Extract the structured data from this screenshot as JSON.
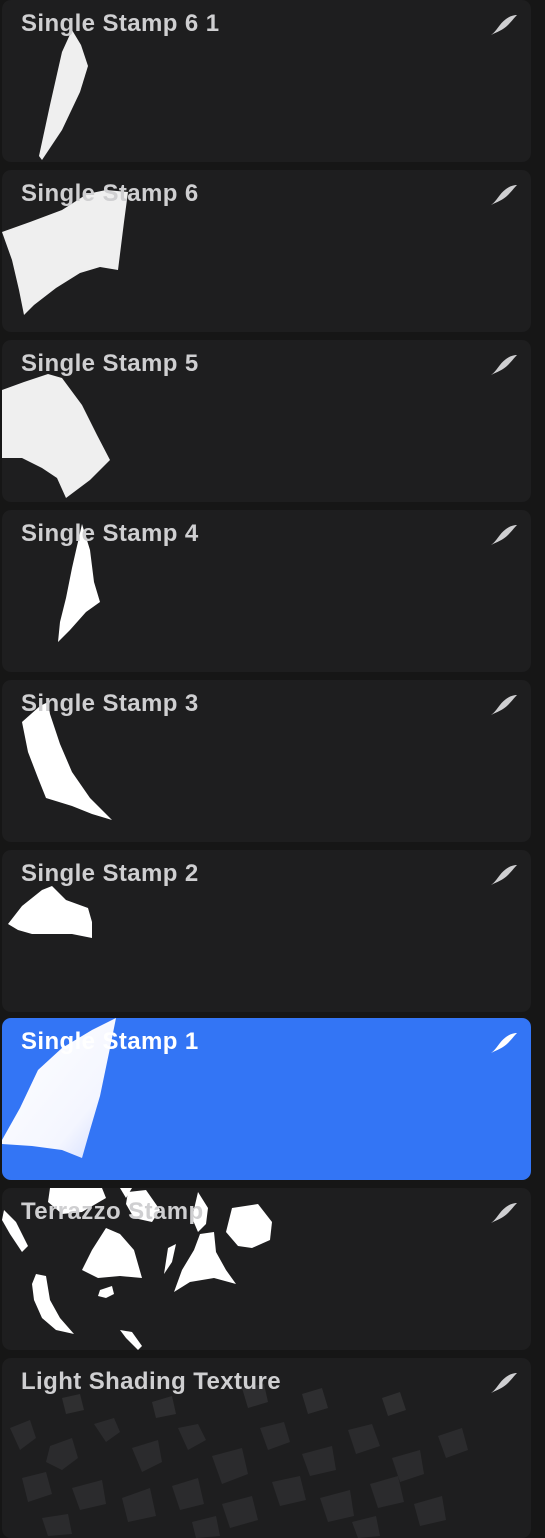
{
  "brushes": [
    {
      "name": "Single Stamp 6 1",
      "selected": false
    },
    {
      "name": "Single Stamp 6",
      "selected": false
    },
    {
      "name": "Single Stamp 5",
      "selected": false
    },
    {
      "name": "Single Stamp 4",
      "selected": false
    },
    {
      "name": "Single Stamp 3",
      "selected": false
    },
    {
      "name": "Single Stamp 2",
      "selected": false
    },
    {
      "name": "Single Stamp 1",
      "selected": true
    },
    {
      "name": "Terrazzo Stamp",
      "selected": false
    },
    {
      "name": "Light Shading Texture",
      "selected": false
    }
  ],
  "icons": {
    "brush_source": "procreate-brush-icon"
  },
  "colors": {
    "background": "#161616",
    "card": "#1e1e1f",
    "selected": "#3375f5",
    "label": "#cfcfd1",
    "stamp": "#f2f2f2"
  }
}
